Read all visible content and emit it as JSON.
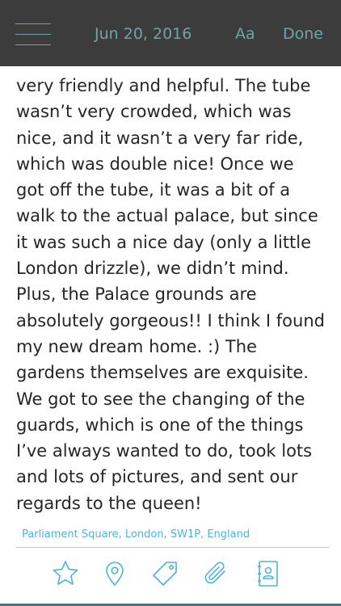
{
  "header": {
    "date": "Jun 20, 2016",
    "font_label": "Aa",
    "done_label": "Done"
  },
  "entry": {
    "lines": [
      "very friendly and helpful. The tube",
      "wasn’t very crowded, which was",
      "nice, and it wasn’t a very far ride,",
      "which was double nice!  Once we",
      "got off the tube, it was a bit of a",
      "walk to the actual palace, but since",
      "it was such a nice day (only a little",
      "London drizzle), we didn’t mind.",
      "Plus, the Palace grounds are",
      "absolutely gorgeous!! I think I found",
      "my new dream home. :) The",
      "gardens themselves are exquisite.",
      "We got to see the changing of the",
      "guards, which is one of the things",
      "I’ve always wanted to do, took lots",
      "and lots of pictures, and sent our",
      "regards to the queen!"
    ]
  },
  "location": "Parliament Square, London, SW1P, England",
  "toolbar": {
    "icons": [
      "star-icon",
      "map-pin-icon",
      "tag-icon",
      "paperclip-icon",
      "contact-book-icon"
    ]
  },
  "colors": {
    "header_bg": "#3c3c3c",
    "header_text": "#6fa3aa",
    "accent": "#4cb4d7",
    "body_text": "#262626"
  }
}
